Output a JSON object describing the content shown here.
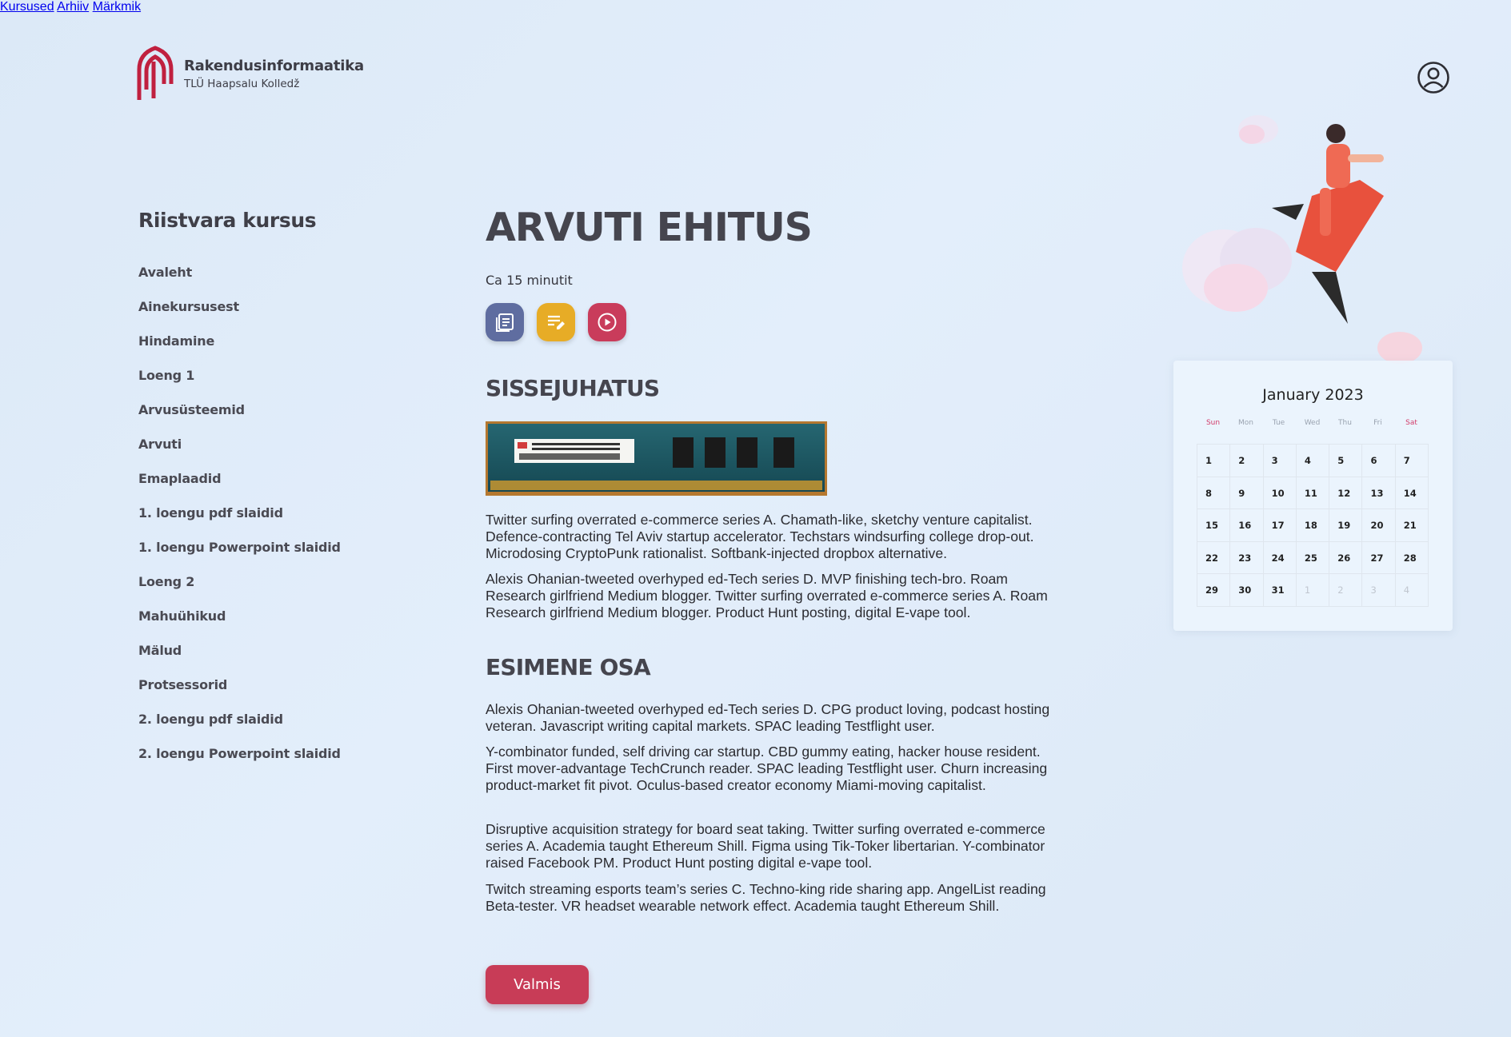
{
  "header": {
    "brand_title": "Rakendusinformaatika",
    "brand_subtitle": "TLÜ Haapsalu Kolledž",
    "nav": [
      "Kursused",
      "Arhiiv",
      "Märkmik"
    ],
    "account_icon": "user-circle-icon"
  },
  "sidebar": {
    "course_title": "Riistvara kursus",
    "items": [
      "Avaleht",
      "Ainekursusest",
      "Hindamine",
      "Loeng 1",
      "Arvusüsteemid",
      "Arvuti",
      "Emaplaadid",
      "1. loengu pdf slaidid",
      "1. loengu Powerpoint slaidid",
      "Loeng 2",
      "Mahuühikud",
      "Mälud",
      "Protsessorid",
      "2. loengu pdf slaidid",
      "2. loengu Powerpoint slaidid"
    ]
  },
  "main": {
    "title": "ARVUTI EHITUS",
    "duration": "Ca 15 minutit",
    "icons": [
      {
        "name": "document-icon",
        "color": "#5f6da0"
      },
      {
        "name": "edit-notes-icon",
        "color": "#e7ac26"
      },
      {
        "name": "play-icon",
        "color": "#c93c5b"
      }
    ],
    "section1_title": "SISSEJUHATUS",
    "section1_image": "ram-module-image",
    "section1_paragraphs": [
      "Twitter surfing overrated e-commerce series A. Chamath-like, sketchy venture capitalist. Defence-contracting Tel Aviv startup accelerator. Techstars windsurfing college drop-out. Microdosing CryptoPunk rationalist. Softbank-injected dropbox alternative.",
      "Alexis Ohanian-tweeted overhyped ed-Tech series D. MVP finishing tech-bro. Roam Research girlfriend Medium blogger. Twitter surfing overrated e-commerce series A. Roam Research girlfriend Medium blogger. Product Hunt posting, digital E-vape tool."
    ],
    "section2_title": "ESIMENE OSA",
    "section2_paragraphs": [
      "Alexis Ohanian-tweeted overhyped ed-Tech series D. CPG product loving, podcast hosting veteran. Javascript writing capital markets. SPAC leading Testflight user.",
      "Y-combinator funded, self driving car startup. CBD gummy eating, hacker house resident. First mover-advantage TechCrunch reader. SPAC leading Testflight user. Churn increasing product-market fit pivot. Oculus-based creator economy Miami-moving capitalist.",
      "Disruptive acquisition strategy for board seat taking. Twitter surfing overrated e-commerce series A. Academia taught Ethereum Shill. Figma using Tik-Toker libertarian. Y-combinator raised Facebook PM. Product Hunt posting digital e-vape tool.",
      "Twitch streaming esports team’s series C. Techno-king ride sharing app. AngelList reading Beta-tester. VR headset wearable network effect. Academia taught Ethereum Shill."
    ],
    "done_label": "Valmis"
  },
  "calendar": {
    "title": "January 2023",
    "weekdays": [
      "Sun",
      "Mon",
      "Tue",
      "Wed",
      "Thu",
      "Fri",
      "Sat"
    ],
    "days": [
      "1",
      "2",
      "3",
      "4",
      "5",
      "6",
      "7",
      "8",
      "9",
      "10",
      "11",
      "12",
      "13",
      "14",
      "15",
      "16",
      "17",
      "18",
      "19",
      "20",
      "21",
      "22",
      "23",
      "24",
      "25",
      "26",
      "27",
      "28",
      "29",
      "30",
      "31",
      "1",
      "2",
      "3",
      "4"
    ],
    "muted_count": 4,
    "weekend_color": "#d23c6a"
  },
  "illustration": "girl-on-rocket-illustration"
}
